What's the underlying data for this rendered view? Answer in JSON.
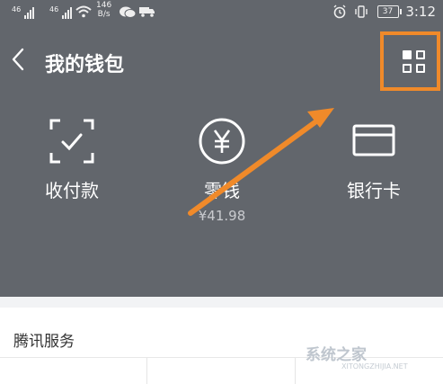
{
  "status_bar": {
    "net1": "46",
    "net2": "46",
    "speed_value": "146",
    "speed_unit": "B/s",
    "battery": "37",
    "time": "3:12"
  },
  "nav": {
    "back_icon": "chevron-left-icon",
    "title": "我的钱包",
    "menu_icon": "grid-icon"
  },
  "wallet_items": [
    {
      "label": "收付款",
      "icon": "scan-check-icon"
    },
    {
      "label": "零钱",
      "icon": "yuan-circle-icon",
      "sub": "¥41.98"
    },
    {
      "label": "银行卡",
      "icon": "bank-card-icon"
    }
  ],
  "section": {
    "title": "腾讯服务"
  },
  "watermark": {
    "text": "系统之家",
    "sub": "XITONGZHIJIA.NET"
  },
  "colors": {
    "header_bg": "#62666c",
    "highlight": "#f08a2a"
  }
}
